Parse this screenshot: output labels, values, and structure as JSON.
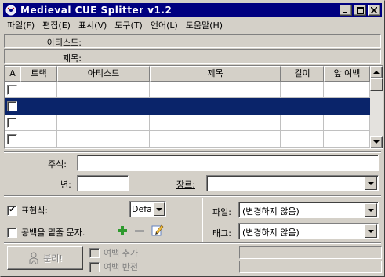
{
  "window": {
    "title": "Medieval CUE Splitter v1.2",
    "controls": [
      "_",
      "□",
      "×"
    ]
  },
  "menu": {
    "items": [
      "파일(F)",
      "편집(E)",
      "표시(V)",
      "도구(T)",
      "언어(L)",
      "도움말(H)"
    ]
  },
  "info": {
    "artist_label": "아티스드:",
    "artist_value": "",
    "title_label": "제목:",
    "title_value": ""
  },
  "tracks": {
    "columns": [
      "A",
      "트랙",
      "아티스드",
      "제목",
      "길이",
      "앞 여백"
    ],
    "rows": [
      {
        "checked": false,
        "track": "",
        "artist": "",
        "title": "",
        "length": "",
        "pregap": "",
        "selected": false
      },
      {
        "checked": false,
        "track": "",
        "artist": "",
        "title": "",
        "length": "",
        "pregap": "",
        "selected": true
      },
      {
        "checked": false,
        "track": "",
        "artist": "",
        "title": "",
        "length": "",
        "pregap": "",
        "selected": false
      },
      {
        "checked": false,
        "track": "",
        "artist": "",
        "title": "",
        "length": "",
        "pregap": "",
        "selected": false
      }
    ]
  },
  "meta": {
    "comment_label": "주석:",
    "comment_value": "",
    "year_label": "년:",
    "year_value": "",
    "genre_label": "장르:",
    "genre_value": ""
  },
  "options": {
    "expression_label": "표현식:",
    "expression_checked": true,
    "expression_select": "Defa",
    "space_label": "공백을 밑줄 문자.",
    "space_checked": false,
    "file_label": "파일:",
    "file_value": "(변경하지 않음)",
    "tag_label": "태그:",
    "tag_value": "(변경하지 않음)"
  },
  "bottom": {
    "split_label": "분리!",
    "gap_add_label": "여백 추가",
    "gap_reverse_label": "여백 반전"
  },
  "colors": {
    "titlebar": "#000080",
    "selection": "#0a246a",
    "face": "#d4d0c8",
    "add_icon": "#2e9a2e"
  }
}
